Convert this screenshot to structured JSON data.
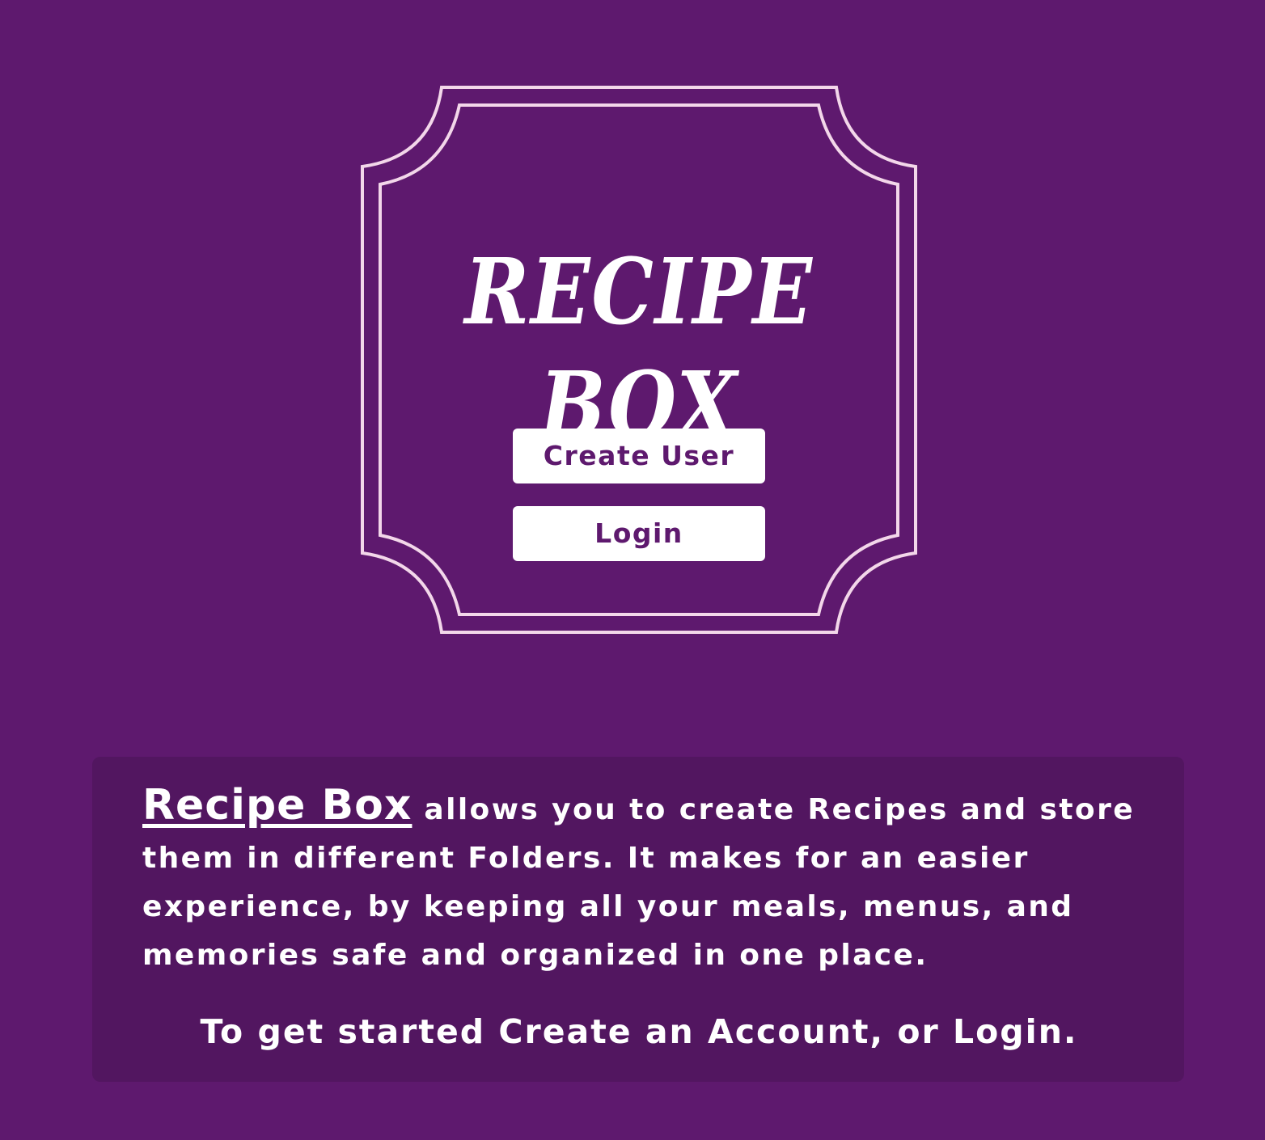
{
  "logo": {
    "title": "RECIPE BOX"
  },
  "buttons": {
    "create_user": "Create User",
    "login": "Login"
  },
  "info": {
    "brand": "Recipe Box",
    "description": " allows you to create Recipes and store them in different Folders. It makes for an easier experience, by keeping all your meals, menus, and memories safe and organized in one place.",
    "cta": "To get started Create an Account, or Login."
  },
  "colors": {
    "background": "#5e196e",
    "panel": "#521660",
    "frame": "#f3d7ea",
    "button_text": "#5e196e"
  }
}
